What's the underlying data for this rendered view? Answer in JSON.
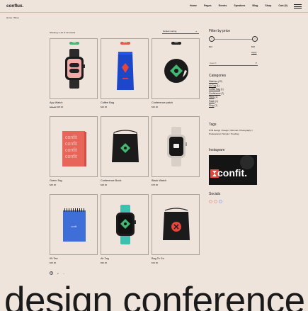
{
  "header": {
    "logo": "conflux.",
    "nav": [
      "Home",
      "Pages",
      "Events",
      "Speakers",
      "Blog",
      "Shop",
      "Cart (0)"
    ]
  },
  "breadcrumb": "Home / Shop",
  "shop": {
    "showing": "Showing 1–12 of 12 results",
    "sort_label": "Default sorting",
    "products": [
      {
        "name": "App Watch",
        "price_old": "$79.00",
        "price": "$36.00",
        "badge": "Sale",
        "badge_color": "#43b873",
        "image": "watch-pink"
      },
      {
        "name": "Coffee Bag",
        "price": "$20.00",
        "badge": "New",
        "badge_color": "#e55b4b",
        "image": "coffee-bag"
      },
      {
        "name": "Conference patch",
        "price": "$30.00",
        "badge": "Sold",
        "badge_color": "#222222",
        "image": "patch"
      },
      {
        "name": "Green Tag",
        "price": "$45.00",
        "image": "book-confit"
      },
      {
        "name": "Conference Book",
        "price": "$28.00",
        "image": "drawstring-bag-green"
      },
      {
        "name": "Black Watch",
        "price": "$78.00",
        "image": "watch-black"
      },
      {
        "name": "Kit Tea",
        "price": "$25.00",
        "image": "notebook-blue"
      },
      {
        "name": "Air Tag",
        "price": "$90.00",
        "image": "watch-teal"
      },
      {
        "name": "Bag To Go",
        "price": "$19.00",
        "image": "drawstring-bag-red"
      }
    ],
    "pagination": [
      "1",
      "2",
      "→"
    ]
  },
  "sidebar": {
    "filter_title": "Filter by price",
    "price_min": "$10",
    "price_max": "$90",
    "filter_button": "Apply",
    "search_placeholder": "Search",
    "categories_title": "Categories",
    "categories": [
      {
        "label": "Watches",
        "count": "(12)"
      },
      {
        "label": "Air Tag",
        "count": "(1)"
      },
      {
        "label": "Coffee Bag",
        "count": "(1)"
      },
      {
        "label": "Conference",
        "count": "(7)"
      },
      {
        "label": "Films",
        "count": "(1)"
      },
      {
        "label": "Patch",
        "count": "(1)"
      },
      {
        "label": "Shop",
        "count": "(7)"
      }
    ],
    "tags_title": "Tags",
    "tags": "NTB Design / Design / Minimal / Photography / Professional / Simple / Trending",
    "instagram_title": "Instagram",
    "instagram_text": "confit.",
    "socials_title": "Socials"
  },
  "footer_text": "design conference",
  "colors": {
    "background": "#efe4dc",
    "accent": "#e55b4b",
    "green": "#43b873"
  }
}
